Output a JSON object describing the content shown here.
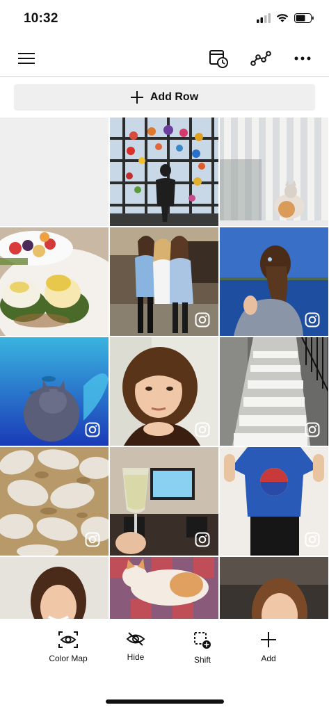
{
  "status_bar": {
    "time": "10:32"
  },
  "toolbar": {
    "add_row_label": "Add Row"
  },
  "grid": {
    "tiles": [
      {
        "name": "empty-slot",
        "instagram": false
      },
      {
        "name": "glass-art-window-photo",
        "instagram": false
      },
      {
        "name": "cat-window-blinds-photo",
        "instagram": false
      },
      {
        "name": "eggs-benedict-photo",
        "instagram": false
      },
      {
        "name": "three-friends-photo",
        "instagram": true
      },
      {
        "name": "girl-by-lake-photo",
        "instagram": true
      },
      {
        "name": "cat-aquarium-photo",
        "instagram": true
      },
      {
        "name": "selfie-photo",
        "instagram": true
      },
      {
        "name": "white-stairs-photo",
        "instagram": true
      },
      {
        "name": "sugared-pastries-photo",
        "instagram": true
      },
      {
        "name": "drink-glass-tv-photo",
        "instagram": true
      },
      {
        "name": "grateful-dead-shirt-photo",
        "instagram": true
      },
      {
        "name": "smiling-girl-photo",
        "instagram": false
      },
      {
        "name": "cat-on-blanket-photo",
        "instagram": false
      },
      {
        "name": "smiling-girl-2-photo",
        "instagram": false
      }
    ]
  },
  "bottom_bar": {
    "color_map": "Color Map",
    "hide": "Hide",
    "shift": "Shift",
    "add": "Add"
  }
}
